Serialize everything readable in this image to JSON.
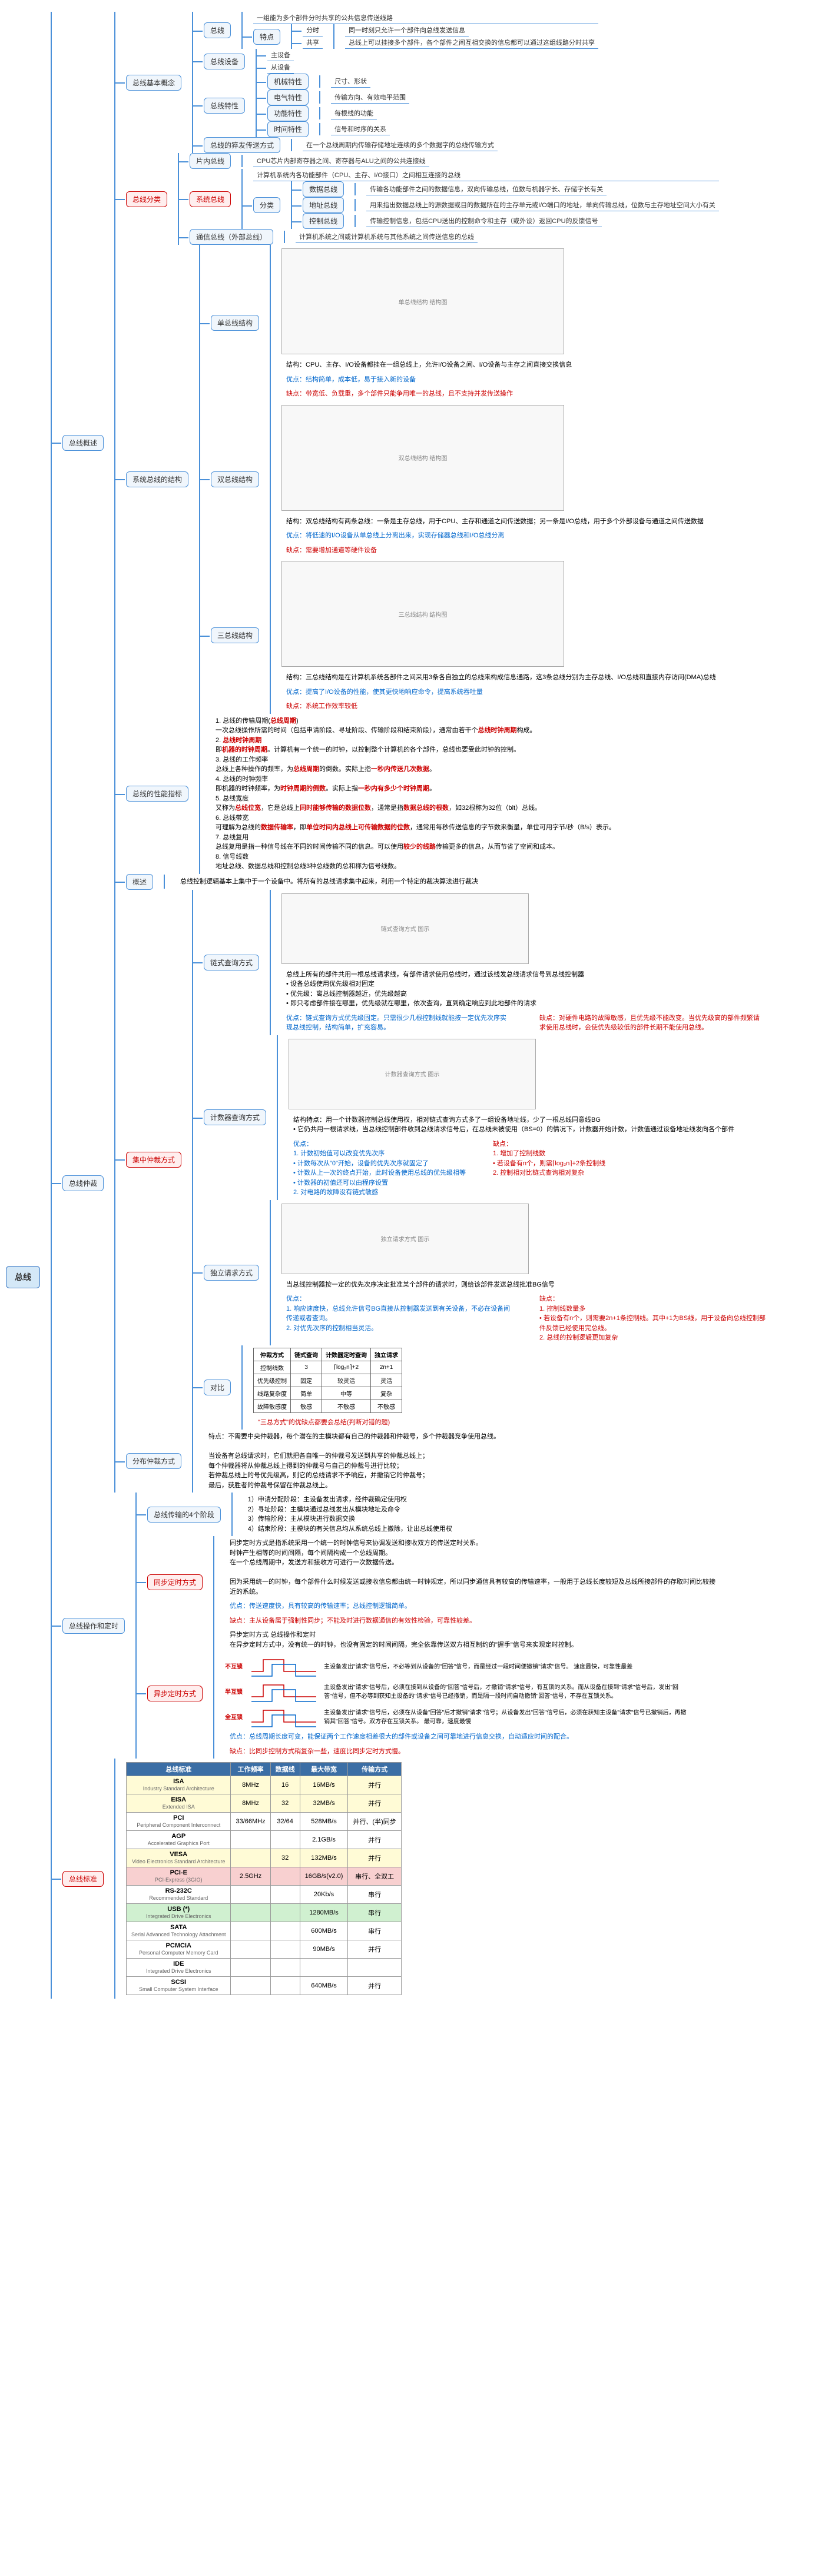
{
  "root": "总线",
  "main_branches": [
    {
      "id": "overview",
      "label": "总线概述",
      "children": [
        {
          "label": "总线基本概念",
          "children": [
            {
              "label": "总线",
              "leaf": "一组能为多个部件分时共享的公共信息传送线路",
              "subchildren": [
                {
                  "label": "特点",
                  "subchildren": [
                    {
                      "label": "分时",
                      "leaf": "同一时刻只允许一个部件向总线发送信息"
                    },
                    {
                      "label": "共享",
                      "leaf": "总线上可以挂接多个部件，各个部件之间互相交换的信息都可以通过这组线路分时共享"
                    }
                  ]
                }
              ]
            },
            {
              "label": "总线设备",
              "subchildren": [
                {
                  "label": "主设备",
                  "leaf": ""
                },
                {
                  "label": "从设备",
                  "leaf": ""
                }
              ]
            },
            {
              "label": "总线特性",
              "subchildren": [
                {
                  "label": "机械特性",
                  "leaf": "尺寸、形状"
                },
                {
                  "label": "电气特性",
                  "leaf": "传输方向、有效电平范围"
                },
                {
                  "label": "功能特性",
                  "leaf": "每根线的功能"
                },
                {
                  "label": "时间特性",
                  "leaf": "信号和时序的关系"
                }
              ]
            },
            {
              "label": "总线的猝发传送方式",
              "leaf": "在一个总线周期内传输存储地址连续的多个数据字的总线传输方式"
            }
          ]
        },
        {
          "label": "总线分类",
          "red": true,
          "children": [
            {
              "label": "片内总线",
              "leaf": "CPU芯片内部寄存器之间、寄存器与ALU之间的公共连接线"
            },
            {
              "label": "系统总线",
              "red": true,
              "leaf": "计算机系统内各功能部件（CPU、主存、I/O接口）之间相互连接的总线",
              "subchildren": [
                {
                  "label": "分类",
                  "subchildren": [
                    {
                      "label": "数据总线",
                      "leaf": "传输各功能部件之间的数据信息，双向传输总线，位数与机器字长、存储字长有关"
                    },
                    {
                      "label": "地址总线",
                      "leaf": "用来指出数据总线上的源数据或目的数据所在的主存单元或I/O端口的地址，单向传输总线，位数与主存地址空间大小有关"
                    },
                    {
                      "label": "控制总线",
                      "leaf": "传输控制信息，包括CPU送出的控制命令和主存（或外设）返回CPU的反馈信号"
                    }
                  ]
                }
              ]
            },
            {
              "label": "通信总线（外部总线）",
              "leaf": "计算机系统之间或计算机系统与其他系统之间传送信息的总线"
            }
          ]
        },
        {
          "label": "系统总线的结构",
          "children": [
            {
              "label": "单总线结构",
              "image": true,
              "notes": [
                "结构：CPU、主存、I/O设备都挂在一组总线上，允许I/O设备之间、I/O设备与主存之间直接交换信息",
                "优点：结构简单，成本低，易于接入新的设备",
                "缺点：带宽低、负载重，多个部件只能争用唯一的总线，且不支持并发传送操作"
              ]
            },
            {
              "label": "双总线结构",
              "image": true,
              "notes": [
                "结构：双总线结构有两条总线：一条是主存总线，用于CPU、主存和通道之间传送数据；另一条是I/O总线，用于多个外部设备与通道之间传送数据",
                "优点：将低速的I/O设备从单总线上分离出来，实现存储器总线和I/O总线分离",
                "缺点：需要增加通道等硬件设备"
              ]
            },
            {
              "label": "三总线结构",
              "image": true,
              "notes": [
                "结构：三总线结构是在计算机系统各部件之间采用3条各自独立的总线来构成信息通路，这3条总线分别为主存总线、I/O总线和直接内存访问(DMA)总线",
                "优点：提高了I/O设备的性能，使其更快地响应命令，提高系统吞吐量",
                "缺点：系统工作效率较低"
              ]
            }
          ]
        },
        {
          "label": "总线的性能指标",
          "textblock": "1. 总线的传输周期(总线周期)\n一次总线操作所需的时间（包括申请阶段、寻址阶段、传输阶段和结束阶段），通常由若干个总线时钟周期构成。\n2. 总线时钟周期\n即机器的时钟周期。计算机有一个统一的时钟，以控制整个计算机的各个部件，总线也要受此时钟的控制。\n3. 总线的工作频率\n总线上各种操作的频率，为总线周期的倒数。实际上指一秒内传送几次数据。\n4. 总线的时钟频率\n即机器的时钟频率，为时钟周期的倒数。实际上指一秒内有多少个时钟周期。\n5. 总线宽度\n又称为总线位宽，它是总线上同时能够传输的数据位数，通常是指数据总线的根数，如32根称为32位（bit）总线。\n6. 总线带宽\n可理解为总线的数据传输率，即单位时间内总线上可传输数据的位数，通常用每秒传送信息的字节数来衡量，单位可用字节/秒（B/s）表示。\n7. 总线复用\n总线复用是指一种信号线在不同的时间传输不同的信息。可以使用较少的线路传输更多的信息，从而节省了空间和成本。\n8. 信号线数\n地址总线、数据总线和控制总线3种总线数的总和称为信号线数。"
        }
      ]
    },
    {
      "id": "arbitration",
      "label": "总线仲裁",
      "children": [
        {
          "label": "概述",
          "textblock": "总线控制逻辑基本上集中于一个设备中。将所有的总线请求集中起来，利用一个特定的裁决算法进行裁决"
        },
        {
          "label": "集中仲裁方式",
          "red": true,
          "children": [
            {
              "label": "链式查询方式",
              "textblock_pre": "总线上所有的部件共用一根总线请求线，有部件请求使用总线时，通过该线发总线请求信号到总线控制器\n• 设备总线使用优先级相对固定\n• 优先级：离总线控制器越近，优先级越高\n• 即只考虑部件接在哪里，优先级就在哪里，依次查询，直到确定响应到此地部件的请求",
              "pros": "优点：链式查询方式优先级固定。只需很少几根控制线就能按一定优先次序实现总线控制，结构简单，扩充容易。",
              "cons": "缺点：对硬件电路的故障敏感，且优先级不能改变。当优先级高的部件频繁请求使用总线时，会使优先级较低的部件长期不能使用总线。"
            },
            {
              "label": "计数器查询方式",
              "textblock_pre": "结构特点：用一个计数器控制总线使用权，相对链式查询方式多了一组设备地址线，少了一根总线同意线BG\n• 它仍共用一根请求线，当总线控制部件收到总线请求信号后，在总线未被使用（BS=0）的情况下，计数器开始计数，计数值通过设备地址线发向各个部件",
              "pros": "优点：\n1. 计数初始值可以改变优先次序\n• 计数每次从\"0\"开始，设备的优先次序就固定了\n• 计数从上一次的终点开始，此时设备使用总线的优先级相等\n• 计数器的初值还可以由程序设置\n2. 对电路的故障没有链式敏感",
              "cons": "缺点：\n1. 增加了控制线数\n• 若设备有n个，则需⌈log₂n⌉+2条控制线\n2. 控制相对比链式查询相对复杂"
            },
            {
              "label": "独立请求方式",
              "textblock_pre": "当总线控制器按一定的优先次序决定批准某个部件的请求时，则给该部件发送总线批准BG信号",
              "pros": "优点：\n1. 响应速度快，总线允许信号BG直接从控制器发送到有关设备，不必在设备间传递或者查询。\n2. 对优先次序的控制相当灵活。",
              "cons": "缺点：\n1. 控制线数量多\n• 若设备有n个，则需要2n+1条控制线。其中+1为BS线，用于设备向总线控制部件反馈已经使用完总线。\n2. 总线的控制逻辑更加复杂"
            }
          ],
          "compare_table": {
            "header": [
              "仲裁方式",
              "链式查询",
              "计数器定时查询",
              "独立请求"
            ],
            "rows": [
              [
                "控制线数",
                "3",
                "⌈log₂n⌉+2",
                "2n+1"
              ],
              [
                "优先级控制",
                "固定",
                "较灵活",
                "灵活"
              ],
              [
                "线路复杂度",
                "简单",
                "中等",
                "复杂"
              ],
              [
                "故障敏感度",
                "敏感",
                "不敏感",
                "不敏感"
              ]
            ],
            "note": "\"三总方式\"的优缺点都要会总结(判断对错的题)"
          }
        },
        {
          "label": "分布仲裁方式",
          "textblock": "特点：不需要中央仲裁器，每个潜在的主模块都有自己的仲裁器和仲裁号，多个仲裁器竞争使用总线。\n\n当设备有总线请求时，它们就把各自唯一的仲裁号发送到共享的仲裁总线上；\n每个仲裁器将从仲裁总线上得到的仲裁号与自己的仲裁号进行比较；\n若仲裁总线上的号优先级高，则它的总线请求不予响应，并撤销它的仲裁号；\n最后，获胜者的仲裁号保留在仲裁总线上。"
        }
      ]
    },
    {
      "id": "timing",
      "label": "总线操作和定时",
      "children": [
        {
          "label": "总线传输的4个阶段",
          "textblock": "1）申请分配阶段：主设备发出请求，经仲裁确定使用权\n2）寻址阶段：主模块通过总线发出从模块地址及命令\n3）传输阶段：主从模块进行数据交换\n4）结束阶段：主模块的有关信息均从系统总线上撤除，让出总线使用权"
        },
        {
          "label": "同步定时方式",
          "red": true,
          "textblock": "同步定时方式是指系统采用一个统一的时钟信号来协调发送和接收双方的传送定时关系。\n时钟产生相等的时间间隔，每个间隔构成一个总线周期。\n在一个总线周期中，发送方和接收方可进行一次数据传送。\n\n因为采用统一的时钟，每个部件什么时候发送或接收信息都由统一时钟规定，所以同步通信具有较高的传输速率，一般用于总线长度较短及总线所接部件的存取时间比较接近的系统。",
          "pros": "优点：传送速度快，具有较高的传输速率；总线控制逻辑简单。",
          "cons": "缺点：主从设备属于强制性同步；不能及时进行数据通信的有效性检验，可靠性较差。"
        },
        {
          "label": "异步定时方式",
          "red": true,
          "textblock": "异步定时方式 总线操作和定时\n在异步定时方式中，没有统一的时钟，也没有固定的时间间隔，完全依靠传送双方相互制约的\"握手\"信号来实现定时控制。",
          "submodes": [
            {
              "label": "非互锁方式",
              "name": "不互锁",
              "desc": "主设备发出\"请求\"信号后，不必等到从设备的\"回答\"信号，而是经过一段时间便撤销\"请求\"信号。\n速度最快，可靠性最差"
            },
            {
              "label": "半互锁方式",
              "name": "半互锁",
              "desc": "主设备发出\"请求\"信号后，必须在接到从设备的\"回答\"信号后，才撤销\"请求\"信号，有互锁的关系。而从设备在接到\"请求\"信号后，发出\"回答\"信号，但不必等到获知主设备的\"请求\"信号已经撤销，而是隔一段时间自动撤销\"回答\"信号，不存在互锁关系。"
            },
            {
              "label": "全互锁方式",
              "name": "全互锁",
              "desc": "主设备发出\"请求\"信号后，必须在从设备\"回答\"后才撤销\"请求\"信号；从设备发出\"回答\"信号后，必须在获知主设备\"请求\"信号已撤销后，再撤销其\"回答\"信号。双方存在互锁关系。\n最可靠，速度最慢"
            }
          ],
          "pros": "优点：总线周期长度可变，能保证两个工作速度相差很大的部件或设备之间可靠地进行信息交换，自动适应时间的配合。",
          "cons": "缺点：比同步控制方式稍复杂一些，速度比同步定时方式慢。"
        }
      ]
    },
    {
      "id": "standard",
      "label": "总线标准",
      "red": true,
      "table": {
        "header": [
          "总线标准",
          "工作频率",
          "数据线",
          "最大带宽",
          "传输方式"
        ],
        "rows": [
          {
            "cells": [
              "ISA",
              "Industry Standard Architecture",
              "8MHz",
              "16",
              "16MB/s",
              "并行"
            ],
            "cls": "hl-yellow"
          },
          {
            "cells": [
              "EISA",
              "Extended ISA",
              "8MHz",
              "32",
              "32MB/s",
              "并行"
            ],
            "cls": "hl-yellow"
          },
          {
            "cells": [
              "PCI",
              "Peripheral Component Interconnect",
              "33/66MHz",
              "32/64",
              "528MB/s",
              "并行、(半)同步"
            ],
            "cls": ""
          },
          {
            "cells": [
              "AGP",
              "Accelerated Graphics Port",
              "",
              "",
              "2.1GB/s",
              "并行"
            ],
            "cls": ""
          },
          {
            "cells": [
              "VESA",
              "Video Electronics Standard Architecture",
              "",
              "32",
              "132MB/s",
              "并行"
            ],
            "cls": "hl-yellow"
          },
          {
            "cells": [
              "PCI-E",
              "PCI-Express (3GIO)",
              "2.5GHz",
              "",
              "16GB/s(v2.0)",
              "串行、全双工"
            ],
            "cls": "hl-red"
          },
          {
            "cells": [
              "RS-232C",
              "Recommended Standard",
              "",
              "",
              "20Kb/s",
              "串行"
            ],
            "cls": ""
          },
          {
            "cells": [
              "USB (*)",
              "Integrated Drive Electronics",
              "",
              "",
              "1280MB/s",
              "串行"
            ],
            "cls": "hl-green"
          },
          {
            "cells": [
              "SATA",
              "Serial Advanced Technology Attachment",
              "",
              "",
              "600MB/s",
              "串行"
            ],
            "cls": ""
          },
          {
            "cells": [
              "PCMCIA",
              "Personal Computer Memory Card",
              "",
              "",
              "90MB/s",
              "并行"
            ],
            "cls": ""
          },
          {
            "cells": [
              "IDE",
              "Integrated Drive Electronics",
              "",
              "",
              "",
              ""
            ],
            "cls": ""
          },
          {
            "cells": [
              "SCSI",
              "Small Computer System Interface",
              "",
              "",
              "640MB/s",
              "并行"
            ],
            "cls": ""
          }
        ]
      }
    }
  ]
}
